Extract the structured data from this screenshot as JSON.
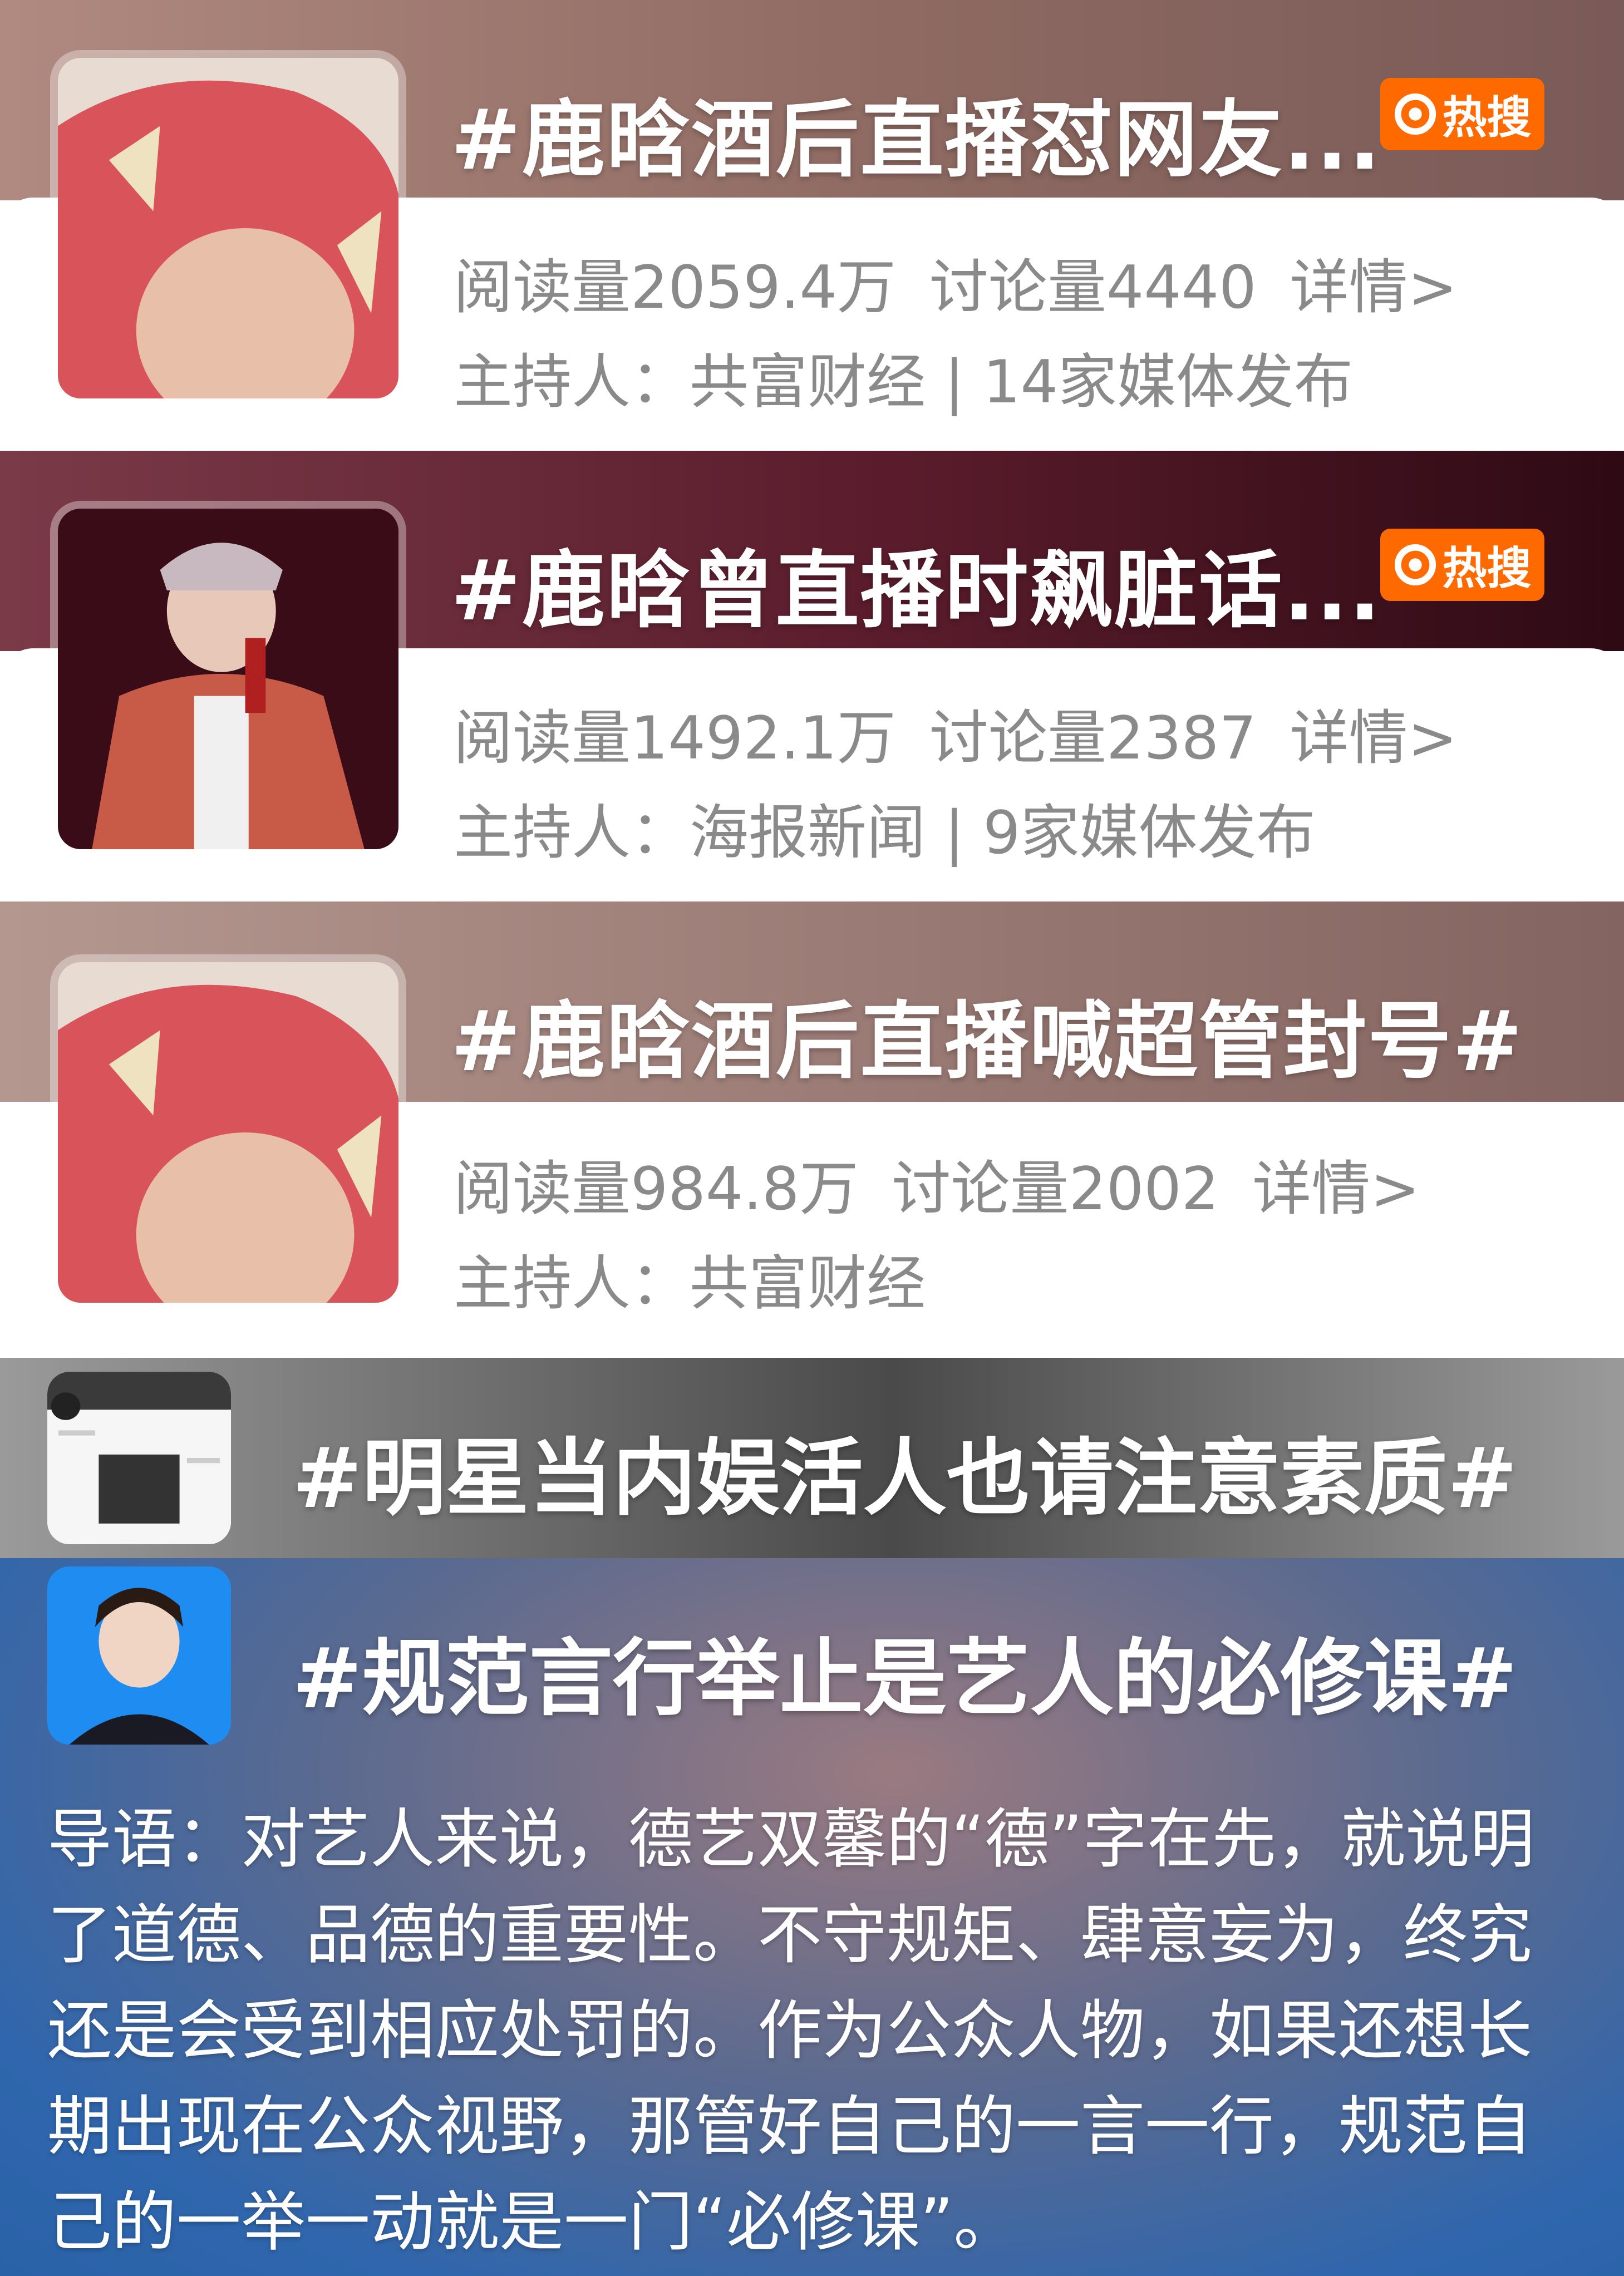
{
  "topics": [
    {
      "title": "#鹿晗酒后直播怼网友...",
      "badge": "热搜",
      "reads": "阅读量2059.4万",
      "discussions": "讨论量4440",
      "detail": "详情>",
      "host": "主持人：共富财经 | 14家媒体发布"
    },
    {
      "title": "#鹿晗曾直播时飙脏话...",
      "badge": "热搜",
      "reads": "阅读量1492.1万",
      "discussions": "讨论量2387",
      "detail": "详情>",
      "host": "主持人：海报新闻 | 9家媒体发布"
    },
    {
      "title": "#鹿晗酒后直播喊超管封号#",
      "reads": "阅读量984.8万",
      "discussions": "讨论量2002",
      "detail": "详情>",
      "host": "主持人：共富财经"
    }
  ],
  "banners": [
    {
      "title": "#明星当内娱活人也请注意素质#"
    },
    {
      "title": "#规范言行举止是艺人的必修课#"
    }
  ],
  "intro": "导语：对艺人来说，德艺双馨的“德”字在先，就说明了道德、品德的重要性。不守规矩、肆意妄为，终究还是会受到相应处罚的。作为公众人物，如果还想长期出现在公众视野，那管好自己的一言一行，规范自己的一举一动就是一门“必修课”。",
  "icons": {
    "badge_icon": "hot-search-icon"
  },
  "colors": {
    "badge": "#ff6a00",
    "card1_header": "#9a7468",
    "card2_header": "#5a1a28",
    "card3_header": "#a08078",
    "banner1": "#6e6e6e",
    "banner2": "#3a6fae"
  }
}
